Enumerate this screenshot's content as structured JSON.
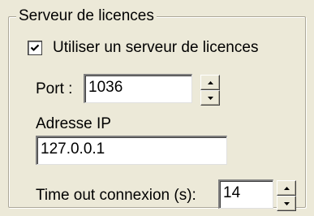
{
  "groupbox": {
    "title": "Serveur de licences"
  },
  "use_server": {
    "label": "Utiliser un serveur de licences",
    "checked": true
  },
  "port": {
    "label": "Port :",
    "value": "1036"
  },
  "ip": {
    "label": "Adresse IP",
    "value": "127.0.0.1"
  },
  "timeout": {
    "label": "Time out connexion (s):",
    "value": "14"
  },
  "icons": {
    "checkmark": "checkmark-icon",
    "spin_up": "arrow-up-icon",
    "spin_down": "arrow-down-icon"
  },
  "colors": {
    "window_bg": "#ece9d8",
    "field_bg": "#ffffff",
    "frame_line": "#aca899"
  }
}
